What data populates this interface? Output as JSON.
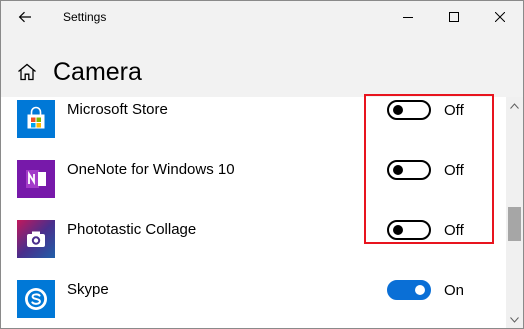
{
  "window": {
    "title": "Settings"
  },
  "page": {
    "title": "Camera"
  },
  "icons": {
    "back": "back-arrow-icon",
    "minimize": "minimize-icon",
    "maximize": "maximize-icon",
    "close": "close-icon",
    "home": "home-icon"
  },
  "apps": [
    {
      "name": "Microsoft Store",
      "state": "Off",
      "on": false,
      "icon": "microsoft-store-icon",
      "color": "#0078d7"
    },
    {
      "name": "OneNote for Windows 10",
      "state": "Off",
      "on": false,
      "icon": "onenote-icon",
      "color": "#7719aa"
    },
    {
      "name": "Phototastic Collage",
      "state": "Off",
      "on": false,
      "icon": "phototastic-collage-icon",
      "color": "#4a2e8c"
    },
    {
      "name": "Skype",
      "state": "On",
      "on": true,
      "icon": "skype-icon",
      "color": "#0078d7"
    }
  ],
  "colors": {
    "accent": "#0a6fd6",
    "highlight": "#e8141e",
    "chrome": "#f2f2f2"
  }
}
